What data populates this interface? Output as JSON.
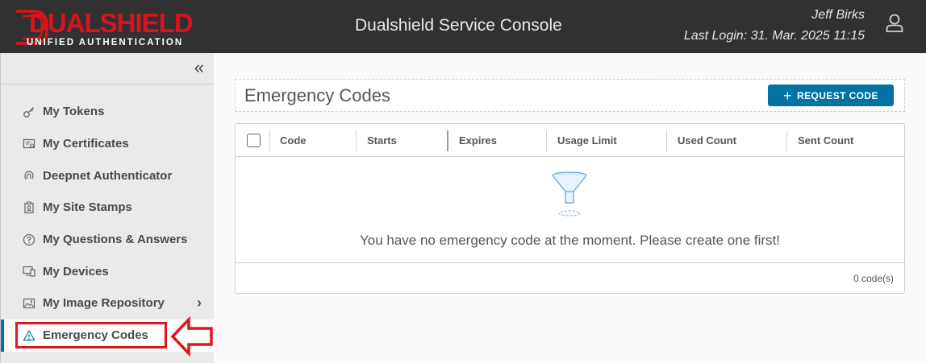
{
  "header": {
    "logo_main": "DUALSHIELD",
    "logo_sub": "UNIFIED AUTHENTICATION",
    "title": "Dualshield Service Console",
    "user_name": "Jeff Birks",
    "last_login": "Last Login: 31. Mar. 2025 11:15"
  },
  "sidebar": {
    "collapse_glyph": "«",
    "items": [
      {
        "label": "My Tokens",
        "icon": "key-icon"
      },
      {
        "label": "My Certificates",
        "icon": "certificate-icon"
      },
      {
        "label": "Deepnet Authenticator",
        "icon": "fingerprint-icon"
      },
      {
        "label": "My Site Stamps",
        "icon": "badge-icon"
      },
      {
        "label": "My Questions & Answers",
        "icon": "question-circle-icon"
      },
      {
        "label": "My Devices",
        "icon": "devices-icon"
      },
      {
        "label": "My Image Repository",
        "icon": "image-icon"
      },
      {
        "label": "Emergency Codes",
        "icon": "warning-icon"
      }
    ]
  },
  "main": {
    "title": "Emergency Codes",
    "request_button": "REQUEST CODE",
    "columns": [
      "Code",
      "Starts",
      "Expires",
      "Usage Limit",
      "Used Count",
      "Sent Count"
    ],
    "empty_message": "You have no emergency code at the moment. Please create one first!",
    "footer_count": "0 code(s)"
  },
  "colors": {
    "header_bg": "#313131",
    "accent": "#0072a3",
    "highlight": "#e0161f",
    "logo_red": "#d7141c"
  }
}
